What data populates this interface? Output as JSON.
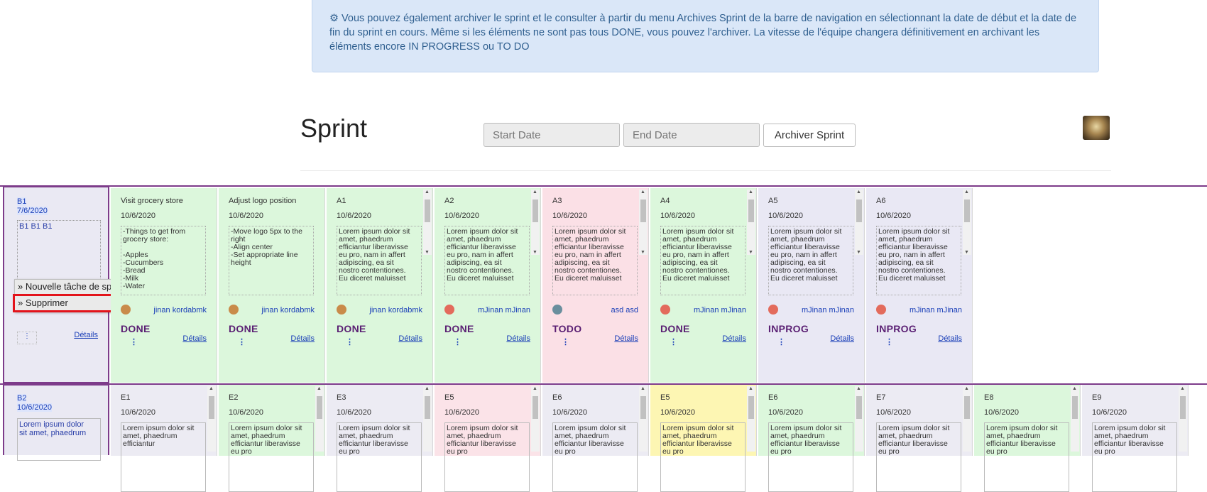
{
  "info_banner": {
    "icon": "gear-icon",
    "text": "Vous pouvez également archiver le sprint et le consulter à partir du menu Archives Sprint de la barre de navigation en sélectionnant la date de début et la date de fin du sprint en cours. Même si les éléments ne sont pas tous DONE, vous pouvez l'archiver. La vitesse de l'équipe changera définitivement en archivant les éléments encore IN PROGRESS ou TO DO"
  },
  "page_title": "Sprint",
  "start_date": {
    "placeholder": "Start Date",
    "value": ""
  },
  "end_date": {
    "placeholder": "End Date",
    "value": ""
  },
  "archive_button": "Archiver Sprint",
  "rows": [
    {
      "id": "B1",
      "date": "7/6/2020",
      "description": "B1 B1 B1",
      "details_label": "Détails",
      "context_menu": [
        "» Nouvelle tâche de sprint",
        "» Supprimer"
      ],
      "cards": [
        {
          "title": "Visit grocery store",
          "date": "10/6/2020",
          "text": "-Things to get from grocery store:\n\n-Apples\n-Cucumbers\n-Bread\n-Milk\n-Water",
          "user": "jinan kordabmk",
          "status": "DONE",
          "details": "Détails",
          "bg": "#dcf7dc",
          "status_color": "#5a1f73"
        },
        {
          "title": "Adjust logo position",
          "date": "10/6/2020",
          "text": "-Move logo 5px to the right\n-Align center\n-Set appropriate line height",
          "user": "jinan kordabmk",
          "status": "DONE",
          "details": "Détails",
          "bg": "#dcf7dc",
          "status_color": "#5a1f73"
        },
        {
          "title": "A1",
          "date": "10/6/2020",
          "text": "Lorem ipsum dolor sit amet, phaedrum efficiantur liberavisse eu pro, nam in affert adipiscing, ea sit nostro contentiones. Eu diceret maluisset",
          "user": "jinan kordabmk",
          "status": "DONE",
          "details": "Détails",
          "bg": "#dcf7dc",
          "status_color": "#5a1f73"
        },
        {
          "title": "A2",
          "date": "10/6/2020",
          "text": "Lorem ipsum dolor sit amet, phaedrum efficiantur liberavisse eu pro, nam in affert adipiscing, ea sit nostro contentiones. Eu diceret maluisset",
          "user": "mJinan mJinan",
          "status": "DONE",
          "details": "Détails",
          "bg": "#dcf7dc",
          "status_color": "#5a1f73"
        },
        {
          "title": "A3",
          "date": "10/6/2020",
          "text": "Lorem ipsum dolor sit amet, phaedrum efficiantur liberavisse eu pro, nam in affert adipiscing, ea sit nostro contentiones. Eu diceret maluisset",
          "user": "asd asd",
          "status": "TODO",
          "details": "Détails",
          "bg": "#fbe0e6",
          "status_color": "#5a1f73"
        },
        {
          "title": "A4",
          "date": "10/6/2020",
          "text": "Lorem ipsum dolor sit amet, phaedrum efficiantur liberavisse eu pro, nam in affert adipiscing, ea sit nostro contentiones. Eu diceret maluisset",
          "user": "mJinan mJinan",
          "status": "DONE",
          "details": "Détails",
          "bg": "#dcf7dc",
          "status_color": "#5a1f73"
        },
        {
          "title": "A5",
          "date": "10/6/2020",
          "text": "Lorem ipsum dolor sit amet, phaedrum efficiantur liberavisse eu pro, nam in affert adipiscing, ea sit nostro contentiones. Eu diceret maluisset",
          "user": "mJinan mJinan",
          "status": "INPROG",
          "details": "Détails",
          "bg": "#e9e8f4",
          "status_color": "#5a1f73"
        },
        {
          "title": "A6",
          "date": "10/6/2020",
          "text": "Lorem ipsum dolor sit amet, phaedrum efficiantur liberavisse eu pro, nam in affert adipiscing, ea sit nostro contentiones. Eu diceret maluisset",
          "user": "mJinan mJinan",
          "status": "INPROG",
          "details": "Détails",
          "bg": "#e9e8f4",
          "status_color": "#5a1f73"
        }
      ]
    },
    {
      "id": "B2",
      "date": "10/6/2020",
      "description": "Lorem ipsum dolor sit amet, phaedrum",
      "cards": [
        {
          "title": "E1",
          "date": "10/6/2020",
          "text": "Lorem ipsum dolor sit amet, phaedrum efficiantur",
          "bg": "#ecebf3"
        },
        {
          "title": "E2",
          "date": "10/6/2020",
          "text": "Lorem ipsum dolor sit amet, phaedrum efficiantur liberavisse eu pro",
          "bg": "#dcf7dc"
        },
        {
          "title": "E3",
          "date": "10/6/2020",
          "text": "Lorem ipsum dolor sit amet, phaedrum efficiantur liberavisse eu pro",
          "bg": "#ecebf3"
        },
        {
          "title": "E5",
          "date": "10/6/2020",
          "text": "Lorem ipsum dolor sit amet, phaedrum efficiantur liberavisse eu pro",
          "bg": "#fbe3e8"
        },
        {
          "title": "E6",
          "date": "10/6/2020",
          "text": "Lorem ipsum dolor sit amet, phaedrum efficiantur liberavisse eu pro",
          "bg": "#ecebf3"
        },
        {
          "title": "E5",
          "date": "10/6/2020",
          "text": "Lorem ipsum dolor sit amet, phaedrum efficiantur liberavisse eu pro",
          "bg": "#fdf6b3"
        },
        {
          "title": "E6",
          "date": "10/6/2020",
          "text": "Lorem ipsum dolor sit amet, phaedrum efficiantur liberavisse eu pro",
          "bg": "#dcf7dc"
        },
        {
          "title": "E7",
          "date": "10/6/2020",
          "text": "Lorem ipsum dolor sit amet, phaedrum efficiantur liberavisse eu pro",
          "bg": "#ecebf3"
        },
        {
          "title": "E8",
          "date": "10/6/2020",
          "text": "Lorem ipsum dolor sit amet, phaedrum efficiantur liberavisse eu pro",
          "bg": "#dcf7dc"
        },
        {
          "title": "E9",
          "date": "10/6/2020",
          "text": "Lorem ipsum dolor sit amet, phaedrum efficiantur liberavisse eu pro",
          "bg": "#ecebf3"
        }
      ]
    }
  ]
}
